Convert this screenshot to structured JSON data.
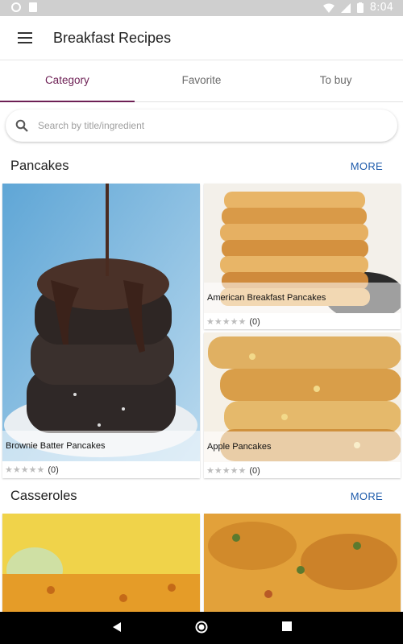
{
  "status_bar": {
    "time": "8:04"
  },
  "app_bar": {
    "title": "Breakfast Recipes"
  },
  "tabs": [
    {
      "label": "Category",
      "active": true
    },
    {
      "label": "Favorite",
      "active": false
    },
    {
      "label": "To buy",
      "active": false
    }
  ],
  "search": {
    "placeholder": "Search by title/ingredient",
    "value": ""
  },
  "sections": [
    {
      "title": "Pancakes",
      "more_label": "MORE",
      "cards": [
        {
          "title": "Brownie Batter Pancakes",
          "stars": "★★★★★",
          "rating_count": "(0)"
        },
        {
          "title": "American Breakfast Pancakes",
          "stars": "★★★★★",
          "rating_count": "(0)"
        },
        {
          "title": "Apple Pancakes",
          "stars": "★★★★★",
          "rating_count": "(0)"
        }
      ]
    },
    {
      "title": "Casseroles",
      "more_label": "MORE",
      "cards": [
        {
          "title": ""
        },
        {
          "title": ""
        }
      ]
    }
  ],
  "colors": {
    "accent": "#6d1f54",
    "link": "#1e5bab",
    "status_bar": "#cfcfcf"
  }
}
